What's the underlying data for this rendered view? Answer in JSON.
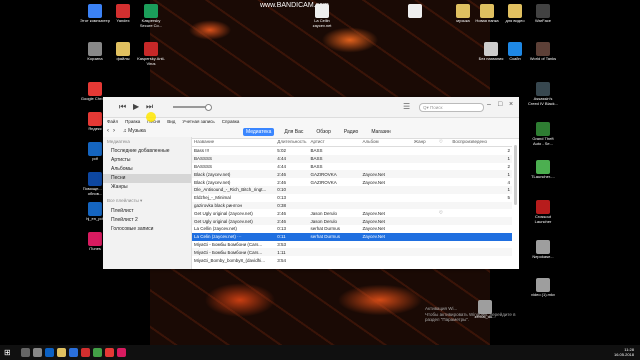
{
  "watermark": "www.BANDICAM.com",
  "desktop_left": [
    {
      "label": "Этот компьютер",
      "color": "#3b82f6"
    },
    {
      "label": "Yandex",
      "color": "#d32f2f"
    },
    {
      "label": "Kaspersky Secure Co...",
      "color": "#1b9e5a"
    },
    {
      "label": "Корзина",
      "color": "#888888"
    },
    {
      "label": "файлы",
      "color": "#e0c060"
    },
    {
      "label": "Kaspersky Anti-Virus",
      "color": "#c62828"
    },
    {
      "label": "Google Chrome",
      "color": "#e53935"
    },
    {
      "label": "Яндекс",
      "color": "#e53935"
    },
    {
      "label": "pdf",
      "color": "#1565c0"
    },
    {
      "label": "Помощн... по обнов...",
      "color": "#0d47a1"
    },
    {
      "label": "hj_en_pdf",
      "color": "#1565c0"
    },
    {
      "label": "iTunes",
      "color": "#d81b60"
    }
  ],
  "desktop_right": [
    {
      "label": "La Cellin zaycev.net",
      "color": "#eeeeee"
    },
    {
      "label": "",
      "color": "#eeeeee"
    },
    {
      "label": "музыка",
      "color": "#e0c060"
    },
    {
      "label": "Новая папка",
      "color": "#e0c060"
    },
    {
      "label": "для видео",
      "color": "#e0c060"
    },
    {
      "label": "WarFace",
      "color": "#424242"
    },
    {
      "label": "Без названия",
      "color": "#cccccc"
    },
    {
      "label": "Скайп",
      "color": "#1e88e5"
    },
    {
      "label": "World of Tanks",
      "color": "#5d4037"
    },
    {
      "label": "Assassin's Creed IV Black...",
      "color": "#37474f"
    },
    {
      "label": "Grand Theft Auto - Se...",
      "color": "#2e7d32"
    },
    {
      "label": "TLauncher-...",
      "color": "#4caf50"
    },
    {
      "label": "Crossout Launcher",
      "color": "#b71c1c"
    },
    {
      "label": "Nepokase...",
      "color": "#9e9e9e"
    },
    {
      "label": "video (1).mkv",
      "color": "#9e9e9e"
    },
    {
      "label": "zerhat_du...",
      "color": "#9e9e9e"
    }
  ],
  "itunes": {
    "search_placeholder": "Q▾ Поиск",
    "menu": [
      "Файл",
      "Правка",
      "Песня",
      "Вид",
      "Учетная запись",
      "Справка"
    ],
    "library_select": "♫ Музыка",
    "tabs": [
      "Медиатека",
      "Для Вас",
      "Обзор",
      "Радио",
      "Магазин"
    ],
    "sidebar": {
      "section1": "Медиатека",
      "items": [
        "Последние добавленные",
        "Артисты",
        "Альбомы",
        "Песни",
        "Жанры"
      ],
      "active_index": 3,
      "section2": "Все плейлисты ▾",
      "playlists": [
        "Плейлист",
        "Плейлист 2",
        "Голосовые записи"
      ]
    },
    "columns": [
      "Название",
      "Длительность",
      "Артист",
      "Альбом",
      "Жанр",
      "♡",
      "Воспроизведено"
    ],
    "rows": [
      [
        "Bass !!!",
        "5:02",
        "BASS",
        "",
        "",
        "",
        "2"
      ],
      [
        "BASSSS",
        "4:44",
        "BASS",
        "",
        "",
        "",
        "1"
      ],
      [
        "BASSSS",
        "4:44",
        "BASS",
        "",
        "",
        "",
        "2"
      ],
      [
        "Black (zaycev.net)",
        "2:46",
        "GAZIROVKA",
        "Zaycev.Net",
        "",
        "",
        "1"
      ],
      [
        "Black (zaycev.net)",
        "2:46",
        "GAZIROVKA",
        "Zaycev.Net",
        "",
        "",
        "4"
      ],
      [
        "Dle_Antisound_-_Rich_Bitch_ringt...",
        "0:10",
        "",
        "",
        "",
        "",
        "1"
      ],
      [
        "Eldzhej_-_Minimal",
        "0:13",
        "",
        "",
        "",
        "",
        "5"
      ],
      [
        "gazirovka black ринггон",
        "0:38",
        "",
        "",
        "",
        "",
        ""
      ],
      [
        "Get Ugly original (zaycev.net)",
        "2:46",
        "Jason Derulo",
        "Zaycev.Net",
        "",
        "♡",
        ""
      ],
      [
        "Get Ugly original (zaycev.net)",
        "2:46",
        "Jason Derulo",
        "Zaycev.Net",
        "",
        "",
        ""
      ],
      [
        "La Cellin (zaycev.net)",
        "0:13",
        "serhat Durmus",
        "Zaycev.Net",
        "",
        "",
        ""
      ],
      [
        "La Celin (zaycev.net) ···",
        "0:11",
        "serhat Durmus",
        "Zaycev.Net",
        "",
        "",
        ""
      ],
      [
        "MiyaGi - Бомбы Бомбони (Cars...",
        "3:53",
        "",
        "",
        "",
        "",
        ""
      ],
      [
        "MiyaGi - Бомбы Бомбони (Cars...",
        "1:11",
        "",
        "",
        "",
        "",
        ""
      ],
      [
        "MiyaGi_Bomby_bomby8_(davidhi...",
        "3:54",
        "",
        "",
        "",
        "",
        ""
      ]
    ],
    "selected_row": 11
  },
  "activation": [
    "Активация Wi...",
    "Чтобы активировать Windows, перейдите в",
    "раздел \"Параметры\"."
  ],
  "clock": {
    "time": "11:28",
    "date": "16.05.2018"
  }
}
